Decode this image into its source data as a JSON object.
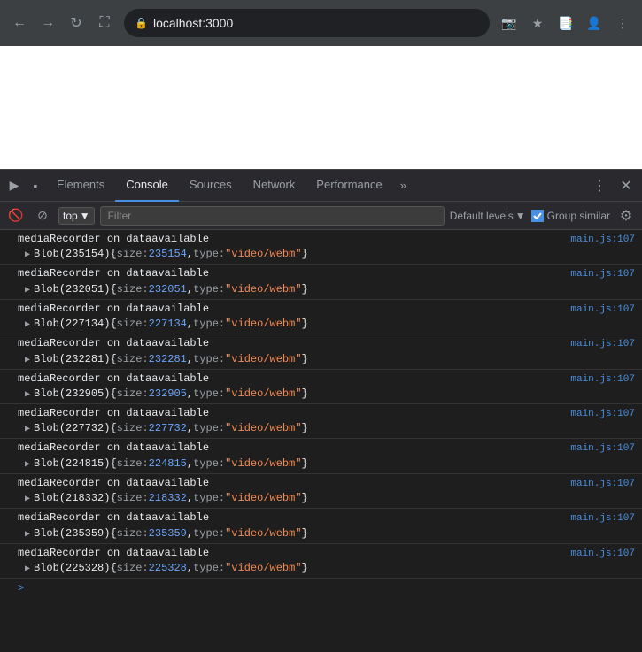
{
  "browser": {
    "url": "localhost:3000",
    "nav_back": "←",
    "nav_forward": "→",
    "nav_reload": "↺",
    "nav_home": "⌂",
    "actions": [
      "📷",
      "★",
      "📑",
      "👤",
      "⋮"
    ]
  },
  "devtools": {
    "tabs": [
      {
        "label": "Elements",
        "active": false
      },
      {
        "label": "Console",
        "active": true
      },
      {
        "label": "Sources",
        "active": false
      },
      {
        "label": "Network",
        "active": false
      },
      {
        "label": "Performance",
        "active": false
      }
    ],
    "more_tabs": "»",
    "toolbar_actions": [
      "⋮",
      "✕"
    ]
  },
  "console_toolbar": {
    "clear_btn": "🚫",
    "filter_btn": "⊘",
    "context": "top",
    "filter_placeholder": "Filter",
    "default_levels": "Default levels",
    "group_similar": "Group similar",
    "settings_icon": "⚙"
  },
  "log_entries": [
    {
      "text": "mediaRecorder on dataavailable",
      "source": "main.js:107",
      "blob": {
        "label": "Blob(235154)",
        "size_key": "size",
        "size_val": "235154",
        "type_key": "type",
        "type_val": "\"video/webm\""
      }
    },
    {
      "text": "mediaRecorder on dataavailable",
      "source": "main.js:107",
      "blob": {
        "label": "Blob(232051)",
        "size_key": "size",
        "size_val": "232051",
        "type_key": "type",
        "type_val": "\"video/webm\""
      }
    },
    {
      "text": "mediaRecorder on dataavailable",
      "source": "main.js:107",
      "blob": {
        "label": "Blob(227134)",
        "size_key": "size",
        "size_val": "227134",
        "type_key": "type",
        "type_val": "\"video/webm\""
      }
    },
    {
      "text": "mediaRecorder on dataavailable",
      "source": "main.js:107",
      "blob": {
        "label": "Blob(232281)",
        "size_key": "size",
        "size_val": "232281",
        "type_key": "type",
        "type_val": "\"video/webm\""
      }
    },
    {
      "text": "mediaRecorder on dataavailable",
      "source": "main.js:107",
      "blob": {
        "label": "Blob(232905)",
        "size_key": "size",
        "size_val": "232905",
        "type_key": "type",
        "type_val": "\"video/webm\""
      }
    },
    {
      "text": "mediaRecorder on dataavailable",
      "source": "main.js:107",
      "blob": {
        "label": "Blob(227732)",
        "size_key": "size",
        "size_val": "227732",
        "type_key": "type",
        "type_val": "\"video/webm\""
      }
    },
    {
      "text": "mediaRecorder on dataavailable",
      "source": "main.js:107",
      "blob": {
        "label": "Blob(224815)",
        "size_key": "size",
        "size_val": "224815",
        "type_key": "type",
        "type_val": "\"video/webm\""
      }
    },
    {
      "text": "mediaRecorder on dataavailable",
      "source": "main.js:107",
      "blob": {
        "label": "Blob(218332)",
        "size_key": "size",
        "size_val": "218332",
        "type_key": "type",
        "type_val": "\"video/webm\""
      }
    },
    {
      "text": "mediaRecorder on dataavailable",
      "source": "main.js:107",
      "blob": {
        "label": "Blob(235359)",
        "size_key": "size",
        "size_val": "235359",
        "type_key": "type",
        "type_val": "\"video/webm\""
      }
    },
    {
      "text": "mediaRecorder on dataavailable",
      "source": "main.js:107",
      "blob": {
        "label": "Blob(225328)",
        "size_key": "size",
        "size_val": "225328",
        "type_key": "type",
        "type_val": "\"video/webm\""
      }
    }
  ]
}
